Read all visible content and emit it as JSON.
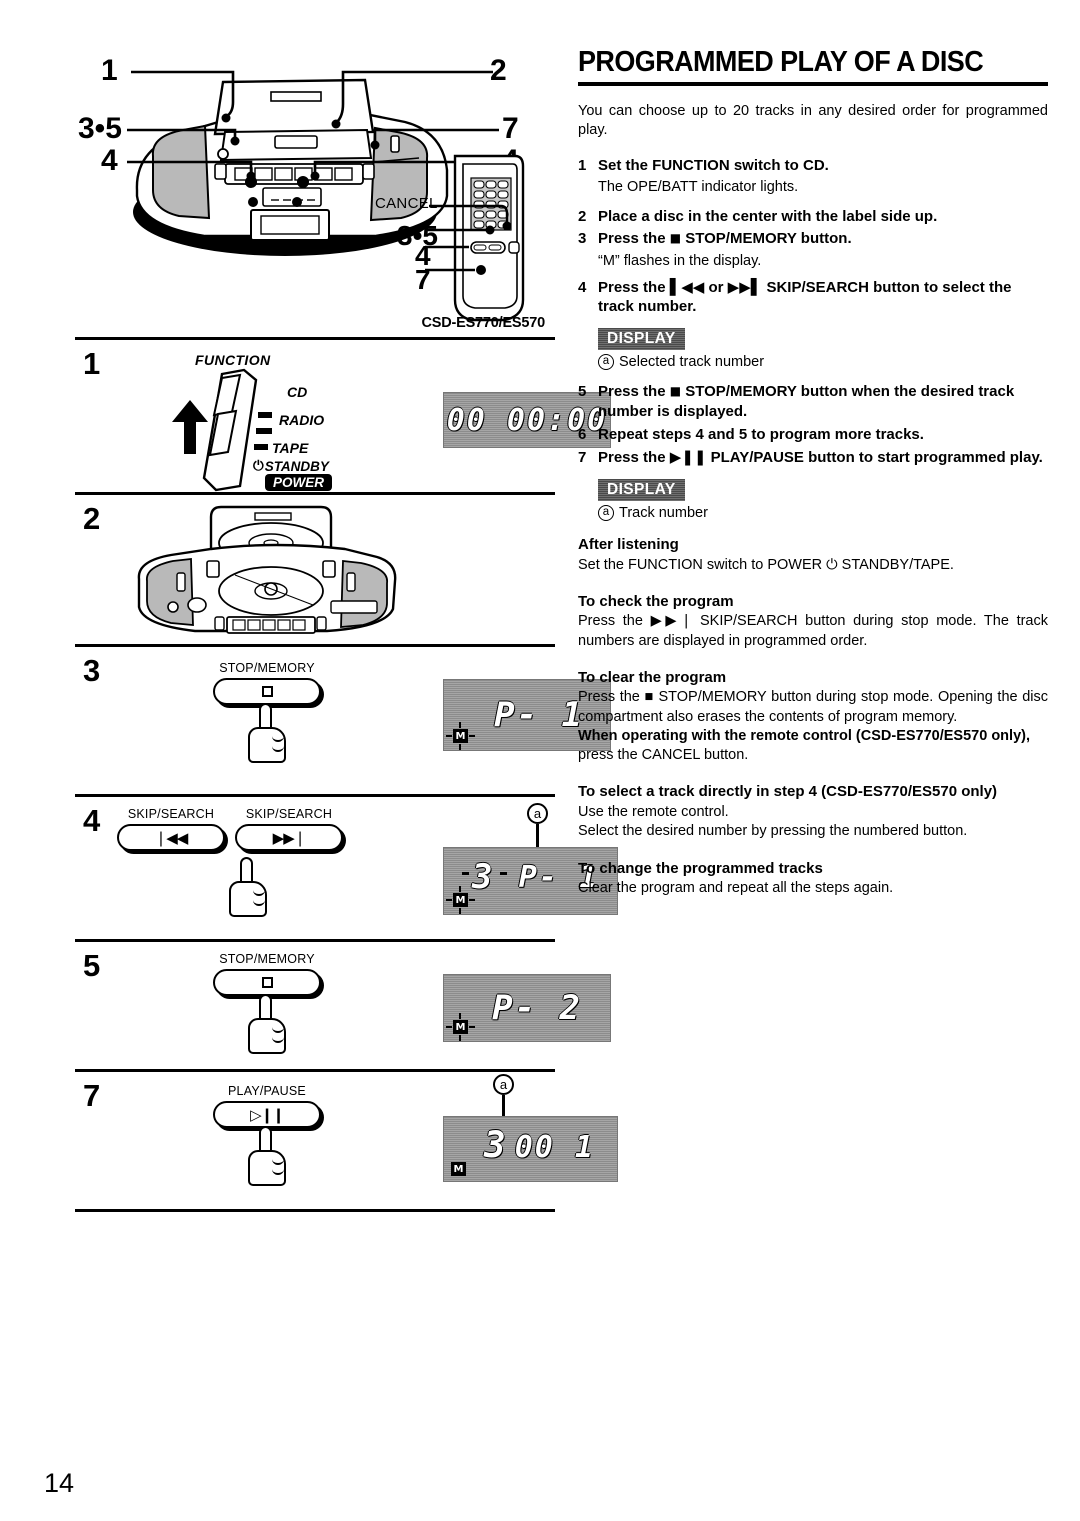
{
  "page": {
    "number": "14"
  },
  "article": {
    "title": "PROGRAMMED PLAY OF A DISC",
    "intro": "You can choose up to 20 tracks in any desired order for programmed play."
  },
  "steps": [
    {
      "num": "1",
      "text": "Set the FUNCTION switch to CD.",
      "note": "The OPE/BATT indicator lights."
    },
    {
      "num": "2",
      "text": "Place a disc in the center with the label side up."
    },
    {
      "num": "3",
      "text_pre": "Press the",
      "icon": "stop-square-icon",
      "text_post": "STOP/MEMORY button.",
      "note": "“M” flashes in the display."
    },
    {
      "num": "4",
      "text_pre": "Press the",
      "icon_prev": "skip-back-icon",
      "text_mid": "or",
      "icon_next": "skip-forward-icon",
      "text_post": "SKIP/SEARCH button to select the track number.",
      "display_badge": "DISPLAY",
      "callout": {
        "marker": "a",
        "label": "Selected track number"
      }
    },
    {
      "num": "5",
      "text_pre": "Press the",
      "icon": "stop-square-icon",
      "text_post": "STOP/MEMORY button when the desired track number is displayed."
    },
    {
      "num": "6",
      "text": "Repeat steps 4 and 5 to program more tracks."
    },
    {
      "num": "7",
      "text_pre": "Press the",
      "icon": "play-pause-icon",
      "text_post": "PLAY/PAUSE button to start programmed play.",
      "display_badge": "DISPLAY",
      "callout": {
        "marker": "a",
        "label": "Track number"
      }
    }
  ],
  "sections": [
    {
      "heading": "After listening",
      "body": "Set the FUNCTION switch to POWER ⏻ STANDBY/TAPE."
    },
    {
      "heading": "To check the program",
      "body": "Press the ▶▶❘ SKIP/SEARCH button during stop mode. The track numbers are displayed in programmed order."
    },
    {
      "heading": "To clear the program",
      "body": "Press the ■ STOP/MEMORY button during stop mode. Opening the disc compartment also erases the contents of program memory.",
      "body_bold": "When operating with the remote control (CSD-ES770/ES570 only),",
      "body_tail": "press the CANCEL button."
    },
    {
      "heading": "To select a track directly in step 4 (CSD-ES770/ES570 only)",
      "body": "Use the remote control.",
      "body_tail": "Select the desired number by pressing the numbered button."
    },
    {
      "heading": "To change the programmed tracks",
      "body": "Clear the program and repeat all the steps again."
    }
  ],
  "figures": {
    "hero": {
      "callouts": [
        "1",
        "2",
        "3•5",
        "4",
        "4",
        "7"
      ],
      "remote_callouts": [
        "CANCEL",
        "3•5",
        "4",
        "7"
      ],
      "model": "CSD-ES770/ES570"
    },
    "step1": {
      "num": "1",
      "switch_title": "FUNCTION",
      "positions": [
        "CD",
        "RADIO",
        "TAPE"
      ],
      "standby": "STANDBY",
      "power": "POWER",
      "lcd": "00 00:00"
    },
    "step2": {
      "num": "2"
    },
    "step3": {
      "num": "3",
      "button_label": "STOP/MEMORY",
      "lcd": "P- 1",
      "indicator": "M"
    },
    "step4": {
      "num": "4",
      "button_label_left": "SKIP/SEARCH",
      "button_label_right": "SKIP/SEARCH",
      "icon_left": "❘◀◀",
      "icon_right": "▶▶❘",
      "lcd_track": "3",
      "lcd_prog": "P- 1",
      "indicator": "M",
      "marker": "a"
    },
    "step5": {
      "num": "5",
      "button_label": "STOP/MEMORY",
      "lcd": "P- 2",
      "indicator": "M"
    },
    "step7": {
      "num": "7",
      "button_label": "PLAY/PAUSE",
      "icon": "▷❙❙",
      "lcd_track": "3",
      "lcd_time": "00 1",
      "indicator": "M",
      "marker": "a"
    }
  }
}
